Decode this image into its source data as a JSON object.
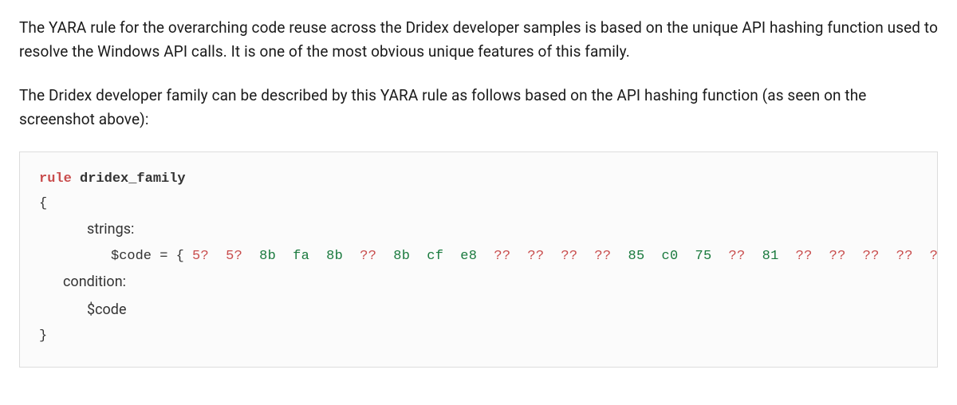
{
  "paragraphs": [
    "The YARA rule for the overarching code reuse across the Dridex developer samples is based on the unique API hashing function used to resolve the Windows API calls. It is one of the most obvious unique features of this family.",
    "The Dridex developer family can be described by this YARA rule as follows based on the API hashing function (as seen on the screenshot above):"
  ],
  "yara": {
    "rule_keyword": "rule",
    "rule_name": "dridex_family",
    "open_brace": "{",
    "close_brace": "}",
    "strings_label": "strings:",
    "condition_label": "condition:",
    "var_name": "$code",
    "equals": " = ",
    "hex_open": "{ ",
    "hex_close": " }",
    "hex_tokens": [
      "5?",
      "5?",
      "8b",
      "fa",
      "8b",
      "??",
      "8b",
      "cf",
      "e8",
      "??",
      "??",
      "??",
      "??",
      "85",
      "c0",
      "75",
      "??",
      "81",
      "??",
      "??",
      "??",
      "??",
      "??"
    ],
    "condition_body": "$code"
  }
}
